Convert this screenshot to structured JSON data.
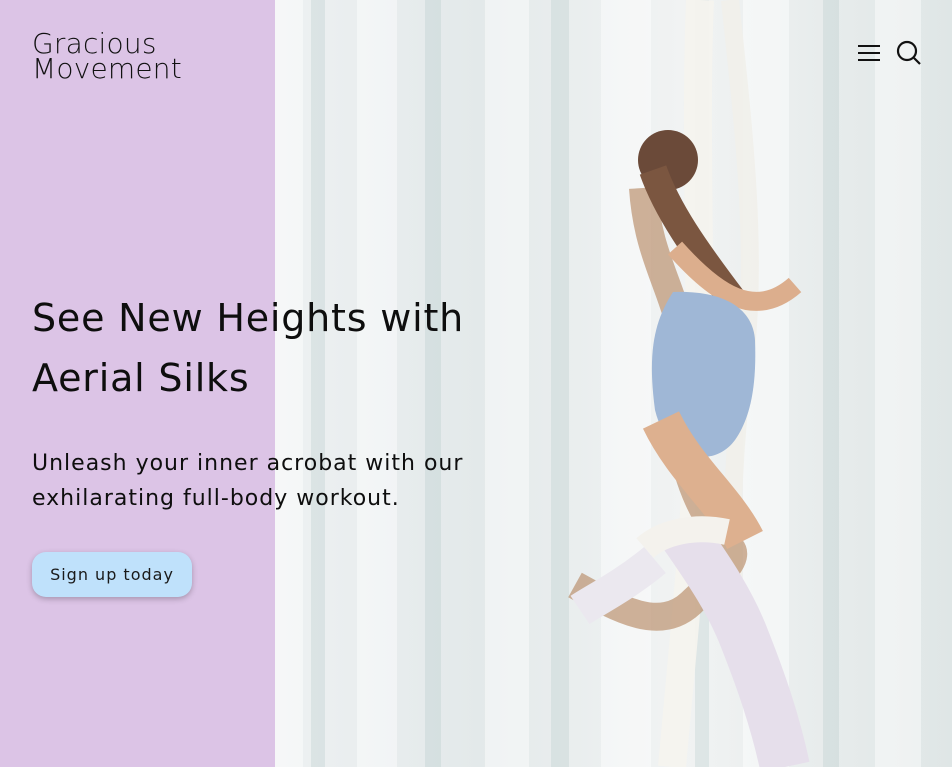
{
  "brand": {
    "logo_line1": "Gracious",
    "logo_line2": "Movement"
  },
  "nav": {
    "menu_icon": "hamburger-menu-icon",
    "search_icon": "search-icon"
  },
  "hero": {
    "headline_line1": "See New Heights with",
    "headline_line2": "Aerial Silks",
    "subheadline_line1": "Unleash your inner acrobat with our",
    "subheadline_line2": "exhilarating full-body workout.",
    "cta_label": "Sign up today",
    "image_description_alt": "Woman performing aerial silks pose"
  },
  "colors": {
    "left_panel": "#dcc4e6",
    "cta_background": "#bfe1fb",
    "text": "#0e0e0e"
  }
}
